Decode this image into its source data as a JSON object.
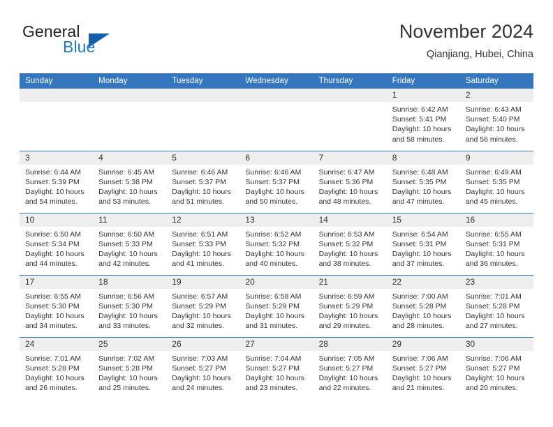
{
  "brand": {
    "general": "General",
    "blue": "Blue",
    "triangle_color": "#1261a8",
    "blue_color": "#1f78c1"
  },
  "header": {
    "title": "November 2024",
    "subtitle": "Qianjiang, Hubei, China"
  },
  "theme": {
    "header_blue": "#3577bf",
    "num_band_gray": "#eeeeee",
    "text": "#333333"
  },
  "weekdays": [
    "Sunday",
    "Monday",
    "Tuesday",
    "Wednesday",
    "Thursday",
    "Friday",
    "Saturday"
  ],
  "weeks": [
    [
      {
        "day": "",
        "sunrise": "",
        "sunset": "",
        "daylight_1": "",
        "daylight_2": ""
      },
      {
        "day": "",
        "sunrise": "",
        "sunset": "",
        "daylight_1": "",
        "daylight_2": ""
      },
      {
        "day": "",
        "sunrise": "",
        "sunset": "",
        "daylight_1": "",
        "daylight_2": ""
      },
      {
        "day": "",
        "sunrise": "",
        "sunset": "",
        "daylight_1": "",
        "daylight_2": ""
      },
      {
        "day": "",
        "sunrise": "",
        "sunset": "",
        "daylight_1": "",
        "daylight_2": ""
      },
      {
        "day": "1",
        "sunrise": "Sunrise: 6:42 AM",
        "sunset": "Sunset: 5:41 PM",
        "daylight_1": "Daylight: 10 hours",
        "daylight_2": "and 58 minutes."
      },
      {
        "day": "2",
        "sunrise": "Sunrise: 6:43 AM",
        "sunset": "Sunset: 5:40 PM",
        "daylight_1": "Daylight: 10 hours",
        "daylight_2": "and 56 minutes."
      }
    ],
    [
      {
        "day": "3",
        "sunrise": "Sunrise: 6:44 AM",
        "sunset": "Sunset: 5:39 PM",
        "daylight_1": "Daylight: 10 hours",
        "daylight_2": "and 54 minutes."
      },
      {
        "day": "4",
        "sunrise": "Sunrise: 6:45 AM",
        "sunset": "Sunset: 5:38 PM",
        "daylight_1": "Daylight: 10 hours",
        "daylight_2": "and 53 minutes."
      },
      {
        "day": "5",
        "sunrise": "Sunrise: 6:46 AM",
        "sunset": "Sunset: 5:37 PM",
        "daylight_1": "Daylight: 10 hours",
        "daylight_2": "and 51 minutes."
      },
      {
        "day": "6",
        "sunrise": "Sunrise: 6:46 AM",
        "sunset": "Sunset: 5:37 PM",
        "daylight_1": "Daylight: 10 hours",
        "daylight_2": "and 50 minutes."
      },
      {
        "day": "7",
        "sunrise": "Sunrise: 6:47 AM",
        "sunset": "Sunset: 5:36 PM",
        "daylight_1": "Daylight: 10 hours",
        "daylight_2": "and 48 minutes."
      },
      {
        "day": "8",
        "sunrise": "Sunrise: 6:48 AM",
        "sunset": "Sunset: 5:35 PM",
        "daylight_1": "Daylight: 10 hours",
        "daylight_2": "and 47 minutes."
      },
      {
        "day": "9",
        "sunrise": "Sunrise: 6:49 AM",
        "sunset": "Sunset: 5:35 PM",
        "daylight_1": "Daylight: 10 hours",
        "daylight_2": "and 45 minutes."
      }
    ],
    [
      {
        "day": "10",
        "sunrise": "Sunrise: 6:50 AM",
        "sunset": "Sunset: 5:34 PM",
        "daylight_1": "Daylight: 10 hours",
        "daylight_2": "and 44 minutes."
      },
      {
        "day": "11",
        "sunrise": "Sunrise: 6:50 AM",
        "sunset": "Sunset: 5:33 PM",
        "daylight_1": "Daylight: 10 hours",
        "daylight_2": "and 42 minutes."
      },
      {
        "day": "12",
        "sunrise": "Sunrise: 6:51 AM",
        "sunset": "Sunset: 5:33 PM",
        "daylight_1": "Daylight: 10 hours",
        "daylight_2": "and 41 minutes."
      },
      {
        "day": "13",
        "sunrise": "Sunrise: 6:52 AM",
        "sunset": "Sunset: 5:32 PM",
        "daylight_1": "Daylight: 10 hours",
        "daylight_2": "and 40 minutes."
      },
      {
        "day": "14",
        "sunrise": "Sunrise: 6:53 AM",
        "sunset": "Sunset: 5:32 PM",
        "daylight_1": "Daylight: 10 hours",
        "daylight_2": "and 38 minutes."
      },
      {
        "day": "15",
        "sunrise": "Sunrise: 6:54 AM",
        "sunset": "Sunset: 5:31 PM",
        "daylight_1": "Daylight: 10 hours",
        "daylight_2": "and 37 minutes."
      },
      {
        "day": "16",
        "sunrise": "Sunrise: 6:55 AM",
        "sunset": "Sunset: 5:31 PM",
        "daylight_1": "Daylight: 10 hours",
        "daylight_2": "and 36 minutes."
      }
    ],
    [
      {
        "day": "17",
        "sunrise": "Sunrise: 6:55 AM",
        "sunset": "Sunset: 5:30 PM",
        "daylight_1": "Daylight: 10 hours",
        "daylight_2": "and 34 minutes."
      },
      {
        "day": "18",
        "sunrise": "Sunrise: 6:56 AM",
        "sunset": "Sunset: 5:30 PM",
        "daylight_1": "Daylight: 10 hours",
        "daylight_2": "and 33 minutes."
      },
      {
        "day": "19",
        "sunrise": "Sunrise: 6:57 AM",
        "sunset": "Sunset: 5:29 PM",
        "daylight_1": "Daylight: 10 hours",
        "daylight_2": "and 32 minutes."
      },
      {
        "day": "20",
        "sunrise": "Sunrise: 6:58 AM",
        "sunset": "Sunset: 5:29 PM",
        "daylight_1": "Daylight: 10 hours",
        "daylight_2": "and 31 minutes."
      },
      {
        "day": "21",
        "sunrise": "Sunrise: 6:59 AM",
        "sunset": "Sunset: 5:29 PM",
        "daylight_1": "Daylight: 10 hours",
        "daylight_2": "and 29 minutes."
      },
      {
        "day": "22",
        "sunrise": "Sunrise: 7:00 AM",
        "sunset": "Sunset: 5:28 PM",
        "daylight_1": "Daylight: 10 hours",
        "daylight_2": "and 28 minutes."
      },
      {
        "day": "23",
        "sunrise": "Sunrise: 7:01 AM",
        "sunset": "Sunset: 5:28 PM",
        "daylight_1": "Daylight: 10 hours",
        "daylight_2": "and 27 minutes."
      }
    ],
    [
      {
        "day": "24",
        "sunrise": "Sunrise: 7:01 AM",
        "sunset": "Sunset: 5:28 PM",
        "daylight_1": "Daylight: 10 hours",
        "daylight_2": "and 26 minutes."
      },
      {
        "day": "25",
        "sunrise": "Sunrise: 7:02 AM",
        "sunset": "Sunset: 5:28 PM",
        "daylight_1": "Daylight: 10 hours",
        "daylight_2": "and 25 minutes."
      },
      {
        "day": "26",
        "sunrise": "Sunrise: 7:03 AM",
        "sunset": "Sunset: 5:27 PM",
        "daylight_1": "Daylight: 10 hours",
        "daylight_2": "and 24 minutes."
      },
      {
        "day": "27",
        "sunrise": "Sunrise: 7:04 AM",
        "sunset": "Sunset: 5:27 PM",
        "daylight_1": "Daylight: 10 hours",
        "daylight_2": "and 23 minutes."
      },
      {
        "day": "28",
        "sunrise": "Sunrise: 7:05 AM",
        "sunset": "Sunset: 5:27 PM",
        "daylight_1": "Daylight: 10 hours",
        "daylight_2": "and 22 minutes."
      },
      {
        "day": "29",
        "sunrise": "Sunrise: 7:06 AM",
        "sunset": "Sunset: 5:27 PM",
        "daylight_1": "Daylight: 10 hours",
        "daylight_2": "and 21 minutes."
      },
      {
        "day": "30",
        "sunrise": "Sunrise: 7:06 AM",
        "sunset": "Sunset: 5:27 PM",
        "daylight_1": "Daylight: 10 hours",
        "daylight_2": "and 20 minutes."
      }
    ]
  ]
}
